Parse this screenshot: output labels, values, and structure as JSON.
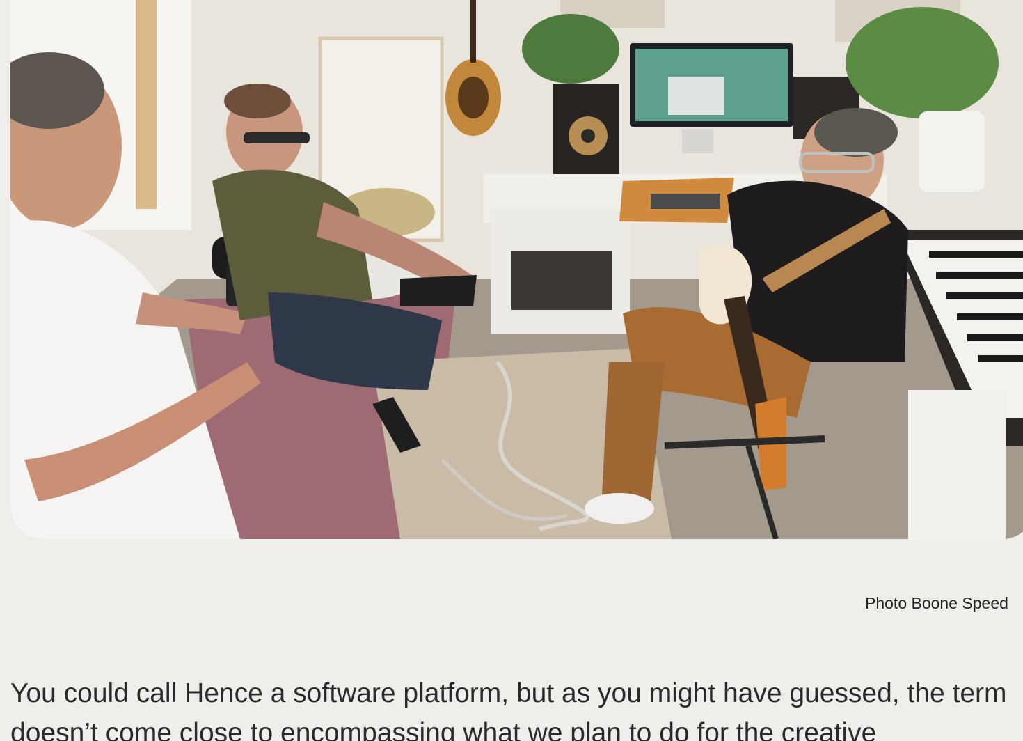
{
  "photo": {
    "alt_subject": "people-in-music-studio"
  },
  "caption": {
    "text": "Photo Boone Speed"
  },
  "article": {
    "paragraph": "You could call Hence a software platform, but as you might have guessed, the term doesn’t come close to encompassing what we plan to do for the creative"
  }
}
